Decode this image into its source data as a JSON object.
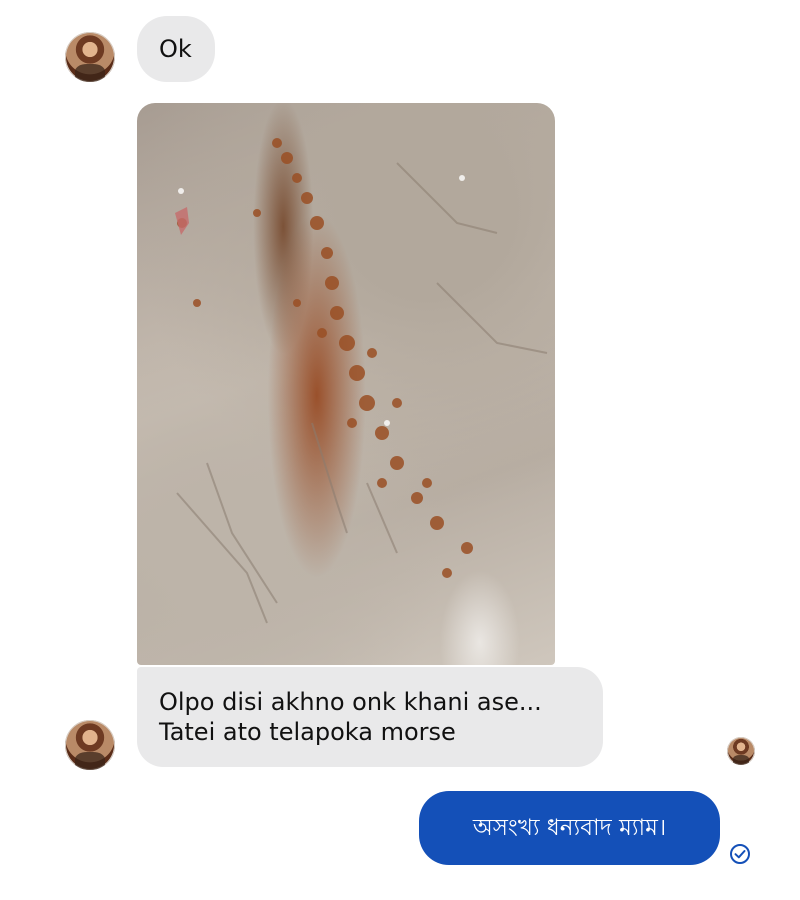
{
  "conversation": {
    "incoming_ok": "Ok",
    "incoming_text_line1": "Olpo disi akhno onk khani ase...",
    "incoming_text_line2": "Tatei ato telapoka morse",
    "outgoing_text": "অসংখ্য ধন্যবাদ ম্যাম।"
  },
  "colors": {
    "incoming_bubble": "#e9e9ea",
    "outgoing_bubble": "#1450b8",
    "read_check": "#1450b8"
  },
  "icons": {
    "sender_avatar": "contact-avatar",
    "photo": "photo-attachment",
    "seen": "seen-avatar",
    "delivered": "check-circle-icon"
  }
}
